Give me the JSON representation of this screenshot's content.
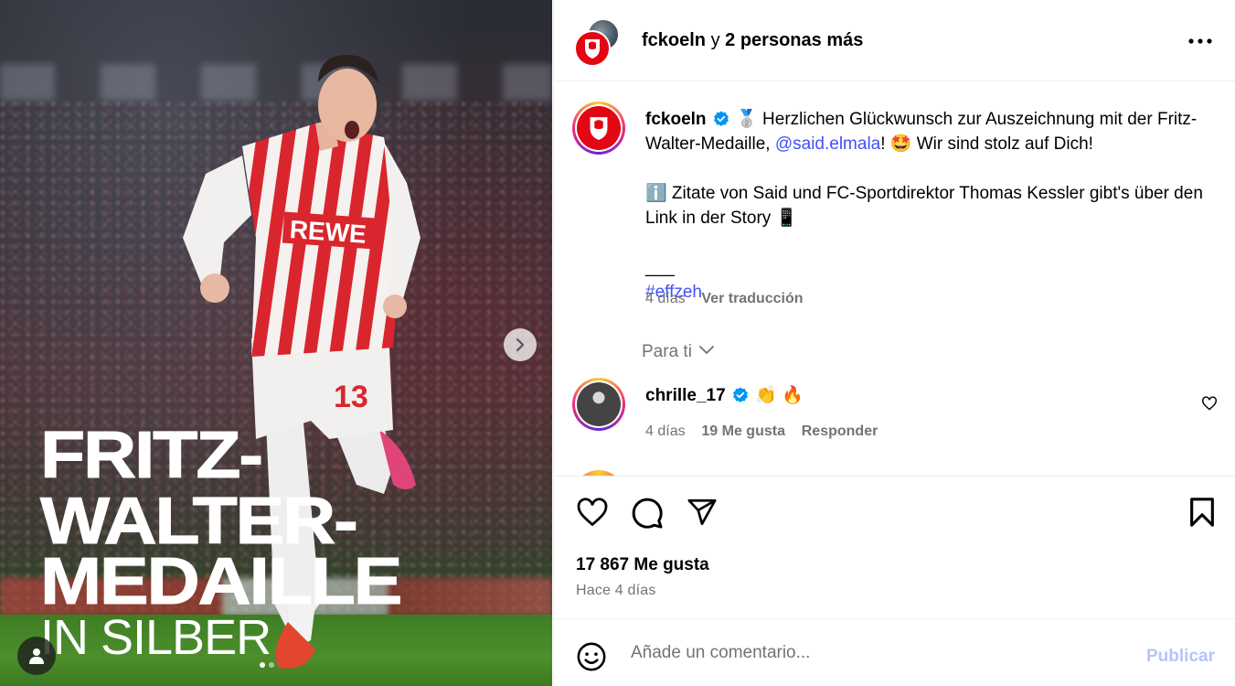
{
  "media": {
    "title_lines": [
      "FRITZ-",
      "WALTER-",
      "MEDAILLE"
    ],
    "subtitle": "IN SILBER",
    "jersey_sponsor": "REWE",
    "jersey_number": "13",
    "carousel": {
      "total": 2,
      "active": 1
    }
  },
  "header": {
    "username": "fckoeln",
    "connector": "y",
    "others": "2 personas más"
  },
  "caption": {
    "username": "fckoeln",
    "medal": "🥈",
    "text_1": " Herzlichen Glückwunsch zur Auszeichnung mit der Fritz-Walter-Medaille, ",
    "mention": "@said.elmala",
    "text_2": "! 🤩 Wir sind stolz auf Dich!",
    "line_2": "ℹ️ Zitate von Said und FC-Sportdirektor Thomas Kessler gibt's über den Link in der Story 📱",
    "divider": "___",
    "hashtag": "#effzeh",
    "age": "4 días",
    "translate": "Ver traducción"
  },
  "for_you": "Para ti",
  "comment": {
    "username": "chrille_17",
    "text": "👏 🔥",
    "age": "4 días",
    "likes": "19 Me gusta",
    "reply": "Responder"
  },
  "post": {
    "likes": "17 867 Me gusta",
    "time": "Hace 4 días"
  },
  "comment_bar": {
    "placeholder": "Añade un comentario...",
    "publish": "Publicar"
  },
  "colors": {
    "brand_red": "#e30613",
    "link": "#4150f7",
    "verified": "#0095f6",
    "muted": "#737373",
    "publish_disabled": "#b3c6f5"
  }
}
